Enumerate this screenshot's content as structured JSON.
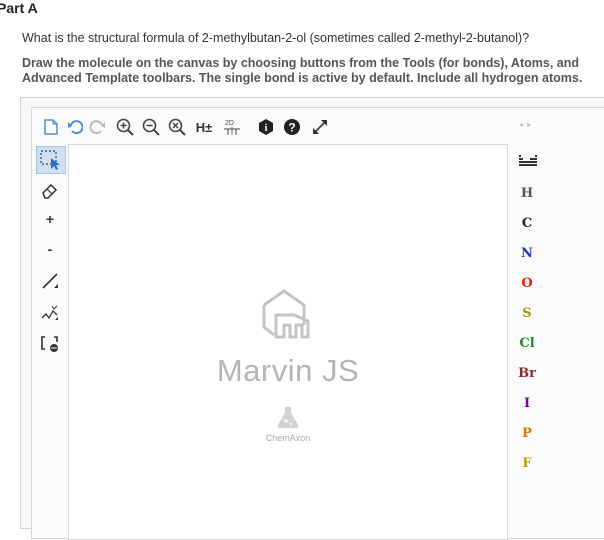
{
  "part_title": "Part A",
  "question": "What is the structural formula of 2-methylbutan-2-ol (sometimes called 2-methyl-2-butanol)?",
  "instructions": "Draw the molecule on the canvas by choosing buttons from the Tools (for bonds), Atoms, and Advanced Template toolbars. The single bond is active by default. Include all hydrogen atoms.",
  "top_toolbar": [
    {
      "name": "new-document-icon"
    },
    {
      "name": "undo-icon"
    },
    {
      "name": "redo-icon"
    },
    {
      "name": "zoom-in-icon"
    },
    {
      "name": "zoom-out-icon"
    },
    {
      "name": "zoom-reset-icon"
    },
    {
      "name": "hydrogens-toggle-icon",
      "label": "H±"
    },
    {
      "name": "2d-clean-icon",
      "label": "2D"
    },
    {
      "name": "info-icon"
    },
    {
      "name": "help-icon"
    },
    {
      "name": "fullscreen-icon"
    }
  ],
  "left_toolbar": [
    {
      "name": "select-tool"
    },
    {
      "name": "erase-tool"
    },
    {
      "name": "increase-charge-tool",
      "label": "+"
    },
    {
      "name": "decrease-charge-tool",
      "label": "-"
    },
    {
      "name": "single-bond-tool"
    },
    {
      "name": "chain-tool"
    },
    {
      "name": "template-tool"
    }
  ],
  "canvas": {
    "watermark_title": "Marvin JS",
    "watermark_company": "ChemAxon"
  },
  "right_toolbar": {
    "nav": "◂ ▸",
    "atoms": [
      {
        "symbol": "H",
        "color": "#555555"
      },
      {
        "symbol": "C",
        "color": "#222222"
      },
      {
        "symbol": "N",
        "color": "#2233cc"
      },
      {
        "symbol": "O",
        "color": "#e8200c"
      },
      {
        "symbol": "S",
        "color": "#a09a00"
      },
      {
        "symbol": "Cl",
        "color": "#1a8a2a"
      },
      {
        "symbol": "Br",
        "color": "#8b2a2a"
      },
      {
        "symbol": "I",
        "color": "#7a00a8"
      },
      {
        "symbol": "P",
        "color": "#d47a00"
      },
      {
        "symbol": "F",
        "color": "#b8a000"
      }
    ]
  }
}
